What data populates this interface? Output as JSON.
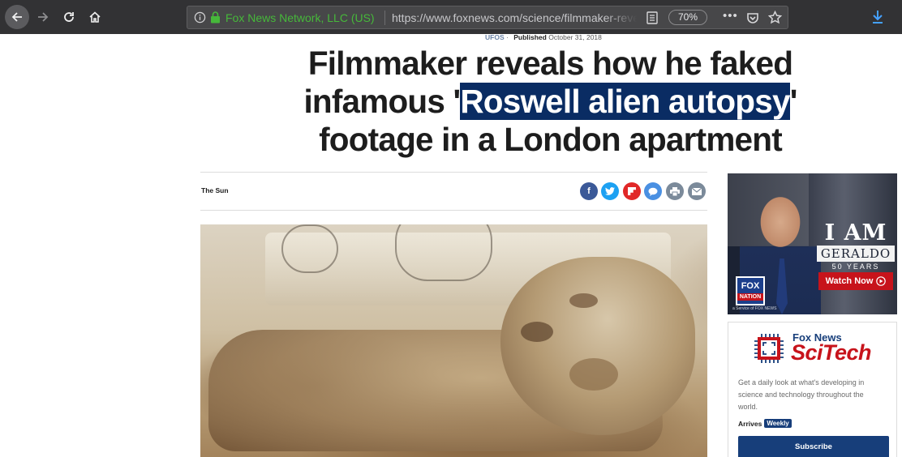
{
  "browser": {
    "identity": "Fox News Network, LLC (US)",
    "url": "https://www.foxnews.com/science/filmmaker-reveals-how-he-faked-infamous-roswell-alien-autopsy-footage",
    "zoom": "70%",
    "identity_color": "#46b83a"
  },
  "article": {
    "category": "UFOS",
    "published_label": "Published",
    "published_date": "October 31, 2018",
    "headline": {
      "line1": "Filmmaker reveals how he faked",
      "line2_before": "infamous '",
      "line2_highlight": "Roswell alien autopsy",
      "line2_after": "'",
      "line3": "footage in a London apartment"
    },
    "source": "The Sun",
    "share_buttons": [
      {
        "icon": "facebook-icon",
        "glyph": "f",
        "color": "#3b5998"
      },
      {
        "icon": "twitter-icon",
        "glyph": "t",
        "color": "#1da1f2"
      },
      {
        "icon": "flipboard-icon",
        "glyph": "F",
        "color": "#e12828"
      },
      {
        "icon": "comment-icon",
        "glyph": "",
        "color": "#4a90e2"
      },
      {
        "icon": "print-icon",
        "glyph": "",
        "color": "#7b8a9a"
      },
      {
        "icon": "email-icon",
        "glyph": "",
        "color": "#7b8a9a"
      }
    ]
  },
  "ad": {
    "title": "I AM",
    "name": "GERALDO",
    "years": "50 YEARS",
    "cta": "Watch Now",
    "logo_top": "FOX",
    "logo_bottom": "NATION",
    "service": "a Service of FOX NEWS"
  },
  "newsletter": {
    "brand": "Fox News",
    "name": "SciTech",
    "description": "Get a daily look at what's developing in science and technology throughout the world.",
    "arrives_label": "Arrives",
    "frequency": "Weekly",
    "button": "Subscribe"
  }
}
